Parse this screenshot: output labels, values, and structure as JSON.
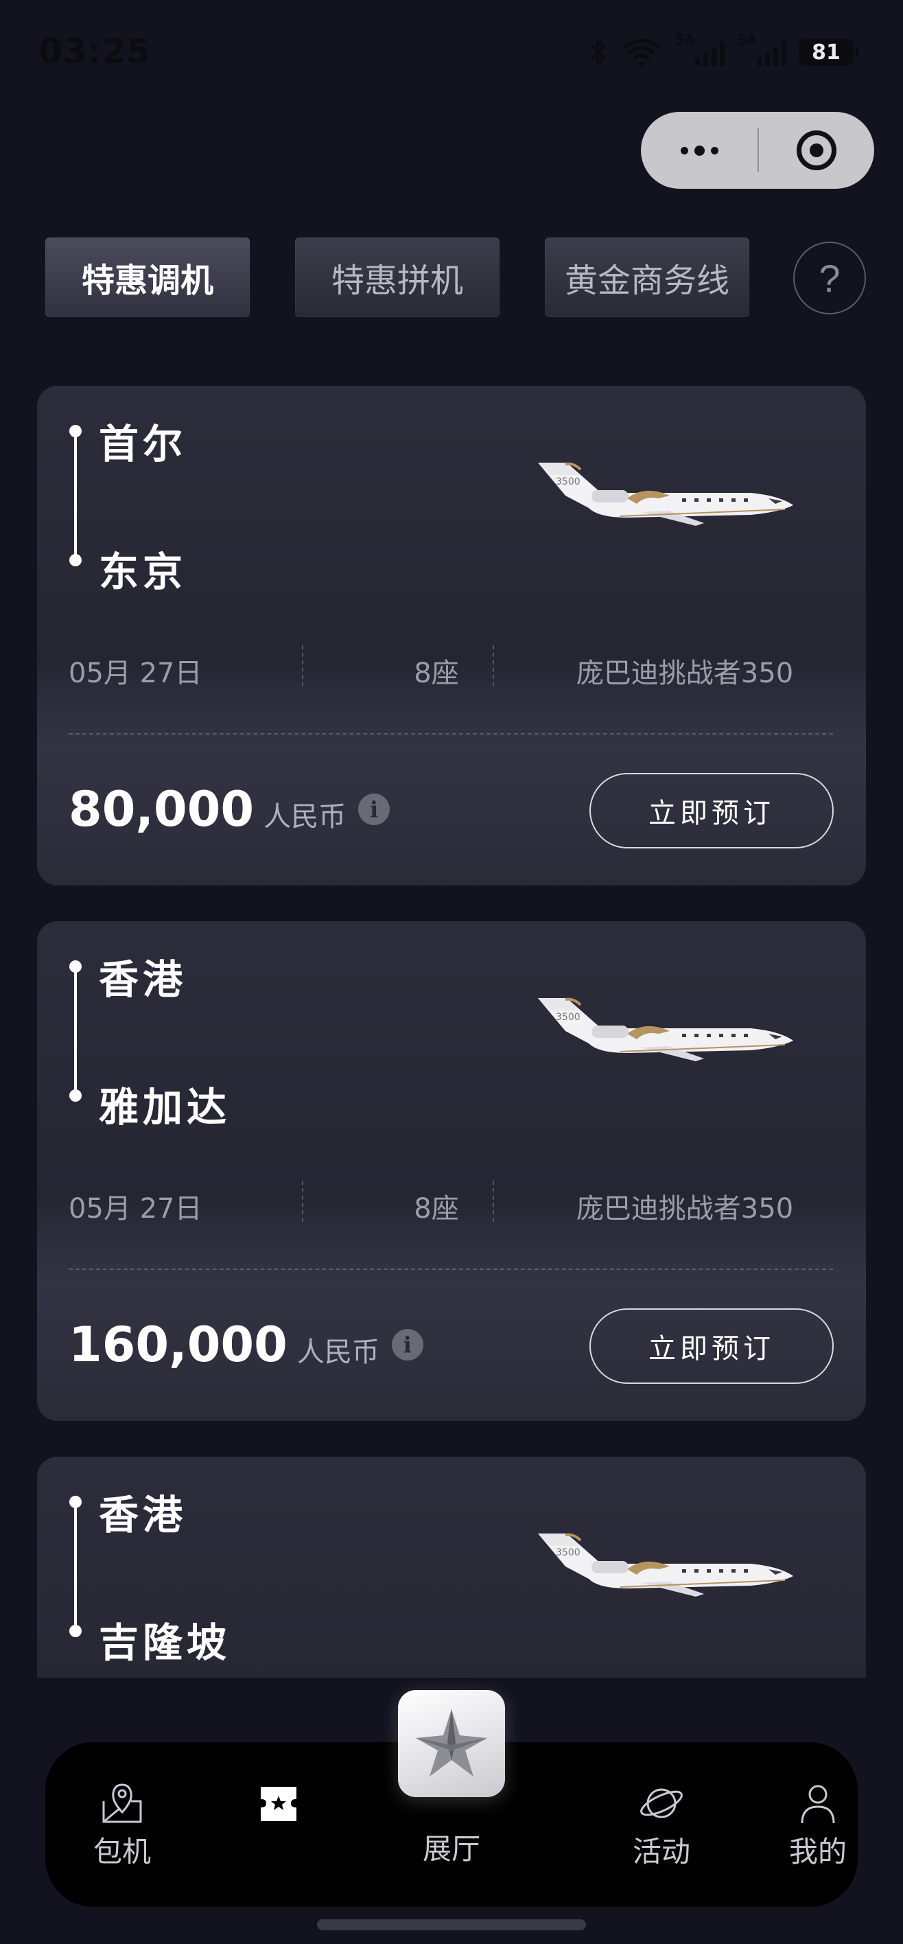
{
  "status_bar": {
    "time": "03:25",
    "signal_1": "5A",
    "signal_2": "5A",
    "battery": "81"
  },
  "tabs": [
    {
      "label": "特惠调机",
      "active": true
    },
    {
      "label": "特惠拼机",
      "active": false
    },
    {
      "label": "黄金商务线",
      "active": false
    }
  ],
  "help_label": "?",
  "flights": [
    {
      "from": "首尔",
      "to": "东京",
      "date": "05月 27日",
      "seats": "8座",
      "model": "庞巴迪挑战者350",
      "price": "80,000",
      "currency": "人民币",
      "book_label": "立即预订"
    },
    {
      "from": "香港",
      "to": "雅加达",
      "date": "05月 27日",
      "seats": "8座",
      "model": "庞巴迪挑战者350",
      "price": "160,000",
      "currency": "人民币",
      "book_label": "立即预订"
    },
    {
      "from": "香港",
      "to": "吉隆坡"
    }
  ],
  "plane_tail_text": "3500",
  "tabbar": {
    "items": [
      {
        "label": "包机",
        "icon": "map-pin-icon"
      },
      {
        "label": "",
        "icon": "ticket-star-icon",
        "active": true
      },
      {
        "label": "展厅",
        "icon": "star-logo-icon"
      },
      {
        "label": "活动",
        "icon": "planet-icon"
      },
      {
        "label": "我的",
        "icon": "person-icon"
      }
    ]
  },
  "colors": {
    "background": "#13131f",
    "card": "#2a2a37",
    "accent_gold": "#b59460"
  }
}
